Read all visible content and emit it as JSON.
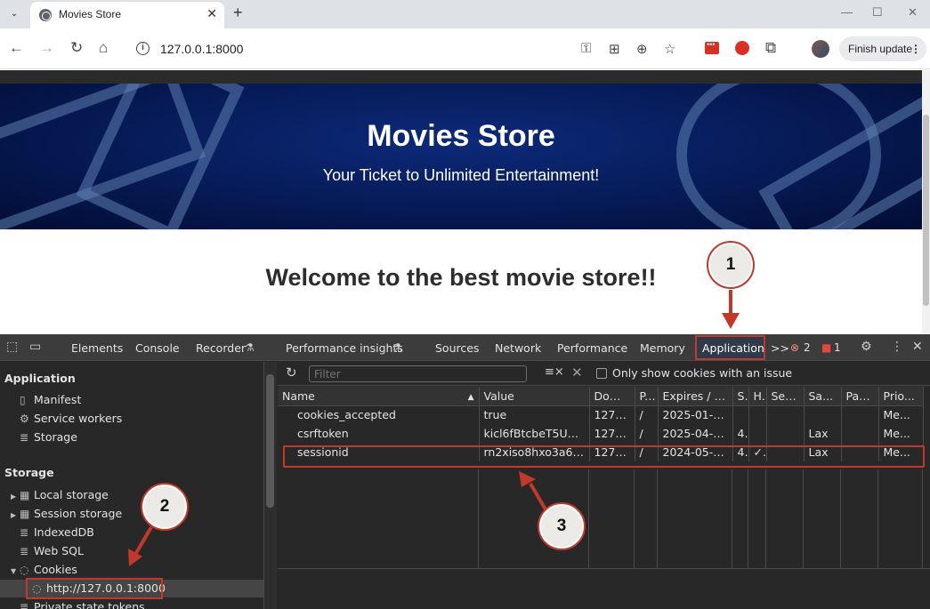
{
  "browser": {
    "tab_title": "Movies Store",
    "url": "127.0.0.1:8000",
    "update_label": "Finish update"
  },
  "page": {
    "hero_title": "Movies Store",
    "hero_subtitle": "Your Ticket to Unlimited Entertainment!",
    "welcome": "Welcome to the best movie store!!"
  },
  "devtools": {
    "tabs": [
      "Elements",
      "Console",
      "Recorder",
      "Performance insights",
      "Sources",
      "Network",
      "Performance",
      "Memory",
      "Application"
    ],
    "more_tabs": ">>",
    "error_count": "2",
    "warning_count": "1",
    "sidebar": {
      "application_header": "Application",
      "application_items": [
        "Manifest",
        "Service workers",
        "Storage"
      ],
      "storage_header": "Storage",
      "storage_items": [
        "Local storage",
        "Session storage",
        "IndexedDB",
        "Web SQL",
        "Cookies"
      ],
      "cookie_origin": "http://127.0.0.1:8000",
      "partial_item": "Private state tokens"
    },
    "filter_placeholder": "Filter",
    "only_issues_label": "Only show cookies with an issue",
    "columns": [
      "Name",
      "Value",
      "Domain",
      "P...",
      "Expires / M...",
      "S.",
      "H.",
      "Sec...",
      "Sa...",
      "Part...",
      "Prio..."
    ],
    "sort_indicator": "▲",
    "cookies": [
      {
        "name": "cookies_accepted",
        "value": "true",
        "domain": "127.0....",
        "path": "/",
        "expires": "2025-01-24...",
        "size": "",
        "httponly": "",
        "secure": "",
        "samesite": "",
        "partition": "",
        "priority": "Me..."
      },
      {
        "name": "csrftoken",
        "value": "kicl6fBtcbeT5U4LN...",
        "domain": "127.0....",
        "path": "/",
        "expires": "2025-04-21...",
        "size": "4...",
        "httponly": "",
        "secure": "",
        "samesite": "Lax",
        "partition": "",
        "priority": "Me..."
      },
      {
        "name": "sessionid",
        "value": "rn2xiso8hxo3a6j6ik...",
        "domain": "127.0....",
        "path": "/",
        "expires": "2024-05-06...",
        "size": "4...",
        "httponly": "✓",
        "secure": "",
        "samesite": "Lax",
        "partition": "",
        "priority": "Me..."
      }
    ]
  },
  "annotations": {
    "step1": "1",
    "step2": "2",
    "step3": "3",
    "highlight_color": "#c0392b"
  }
}
